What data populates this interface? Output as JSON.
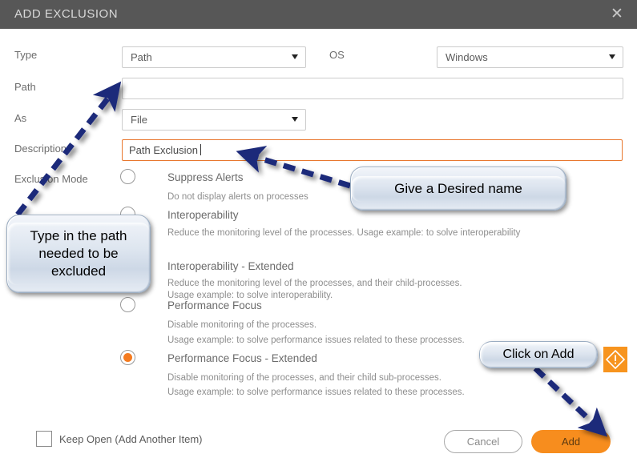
{
  "dialog": {
    "title": "ADD EXCLUSION",
    "close_icon": "close-icon"
  },
  "form": {
    "type": {
      "label": "Type",
      "value": "Path"
    },
    "os": {
      "label": "OS",
      "value": "Windows"
    },
    "path": {
      "label": "Path",
      "value": ""
    },
    "as": {
      "label": "As",
      "value": "File"
    },
    "description": {
      "label": "Description",
      "value": "Path Exclusion"
    },
    "exclusion_mode": {
      "label": "Exclusion Mode"
    }
  },
  "options": [
    {
      "title": "Suppress Alerts",
      "selected": false,
      "desc": [
        "Do not display alerts on processes"
      ]
    },
    {
      "title": "Interoperability",
      "selected": false,
      "desc": [
        "Reduce the monitoring level of the processes. Usage example: to solve interoperability"
      ]
    },
    {
      "title": "Interoperability - Extended",
      "selected": false,
      "desc": [
        "Reduce the monitoring level of the processes, and their child-processes.",
        "Usage example: to solve interoperability."
      ]
    },
    {
      "title": "Performance Focus",
      "selected": false,
      "desc": [
        "Disable monitoring of the processes.",
        "Usage example: to solve performance issues related to these processes."
      ]
    },
    {
      "title": "Performance Focus - Extended",
      "selected": true,
      "desc": [
        "Disable monitoring of the processes, and their child sub-processes.",
        "Usage example: to solve performance issues related to these processes."
      ]
    }
  ],
  "footer": {
    "keep_open_label": "Keep Open (Add Another Item)",
    "keep_open_checked": false,
    "cancel_label": "Cancel",
    "add_label": "Add"
  },
  "alert_tab": {
    "icon": "warning-diamond-icon"
  },
  "annotations": {
    "path_callout": "Type in the path needed to be excluded",
    "name_callout": "Give a Desired name",
    "add_callout": "Click on Add",
    "arrow_color": "#1f2a7a"
  },
  "colors": {
    "titlebar": "#575757",
    "accent_orange": "#f47b20",
    "add_button": "#f78d1e",
    "field_border": "#cccccc",
    "focus_border": "#e8772e"
  }
}
